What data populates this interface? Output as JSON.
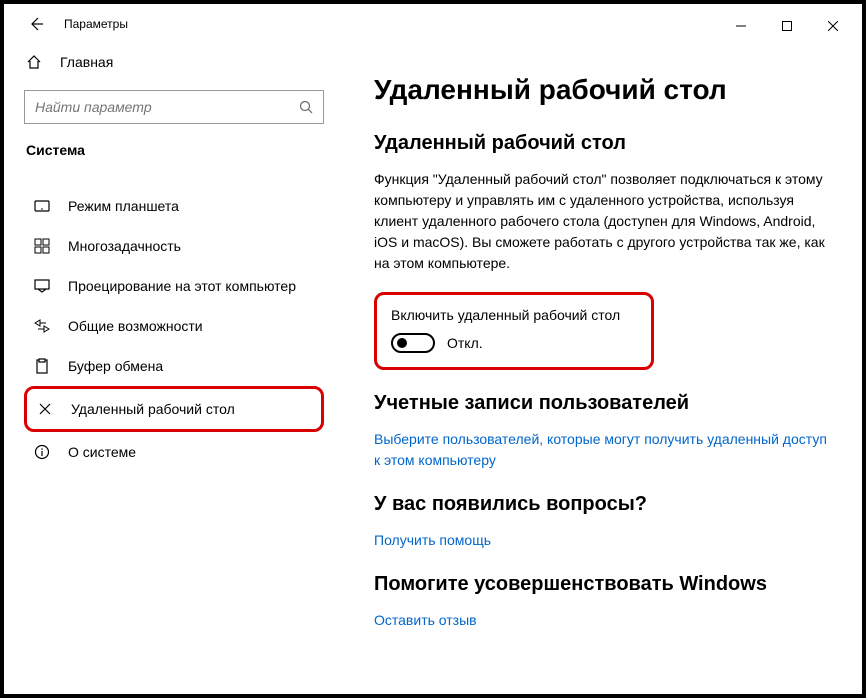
{
  "titlebar": {
    "app_title": "Параметры"
  },
  "sidebar": {
    "home_label": "Главная",
    "search_placeholder": "Найти параметр",
    "category_label": "Система",
    "items": [
      {
        "label": "Режим планшета",
        "icon": "tablet"
      },
      {
        "label": "Многозадачность",
        "icon": "multitask"
      },
      {
        "label": "Проецирование на этот компьютер",
        "icon": "project"
      },
      {
        "label": "Общие возможности",
        "icon": "shared"
      },
      {
        "label": "Буфер обмена",
        "icon": "clipboard"
      },
      {
        "label": "Удаленный рабочий стол",
        "icon": "remote"
      },
      {
        "label": "О системе",
        "icon": "about"
      }
    ]
  },
  "main": {
    "page_title": "Удаленный рабочий стол",
    "rdp_section_title": "Удаленный рабочий стол",
    "rdp_description": "Функция \"Удаленный рабочий стол\" позволяет подключаться к этому компьютеру и управлять им с удаленного устройства, используя клиент удаленного рабочего стола (доступен для Windows, Android, iOS и macOS). Вы сможете работать с другого устройства так же, как на этом компьютере.",
    "toggle_label": "Включить удаленный рабочий стол",
    "toggle_state": "Откл.",
    "users_section_title": "Учетные записи пользователей",
    "users_link": "Выберите пользователей, которые могут получить удаленный доступ к этом компьютеру",
    "help_section_title": "У вас появились вопросы?",
    "help_link": "Получить помощь",
    "feedback_section_title": "Помогите усовершенствовать Windows",
    "feedback_link": "Оставить отзыв"
  }
}
